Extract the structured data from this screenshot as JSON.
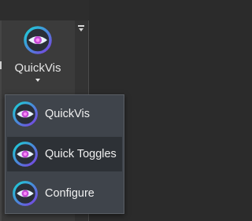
{
  "toolbar": {
    "overflow_icon": "chevron-collapse-icon",
    "tool": {
      "label": "QuickVis",
      "icon": "eye-icon"
    }
  },
  "menu": {
    "items": [
      {
        "label": "QuickVis",
        "icon": "eye-icon",
        "selected": false
      },
      {
        "label": "Quick Toggles",
        "icon": "eye-icon",
        "selected": true
      },
      {
        "label": "Configure",
        "icon": "eye-icon",
        "selected": false
      }
    ]
  },
  "colors": {
    "panel_bg": "#3b3b3b",
    "menu_bg": "#3f444b",
    "menu_selected_bg": "#2d3136",
    "icon_ring_cyan": "#19d3d6",
    "icon_ring_purple": "#7b3fe0",
    "icon_pupil": "#e64cf0"
  }
}
